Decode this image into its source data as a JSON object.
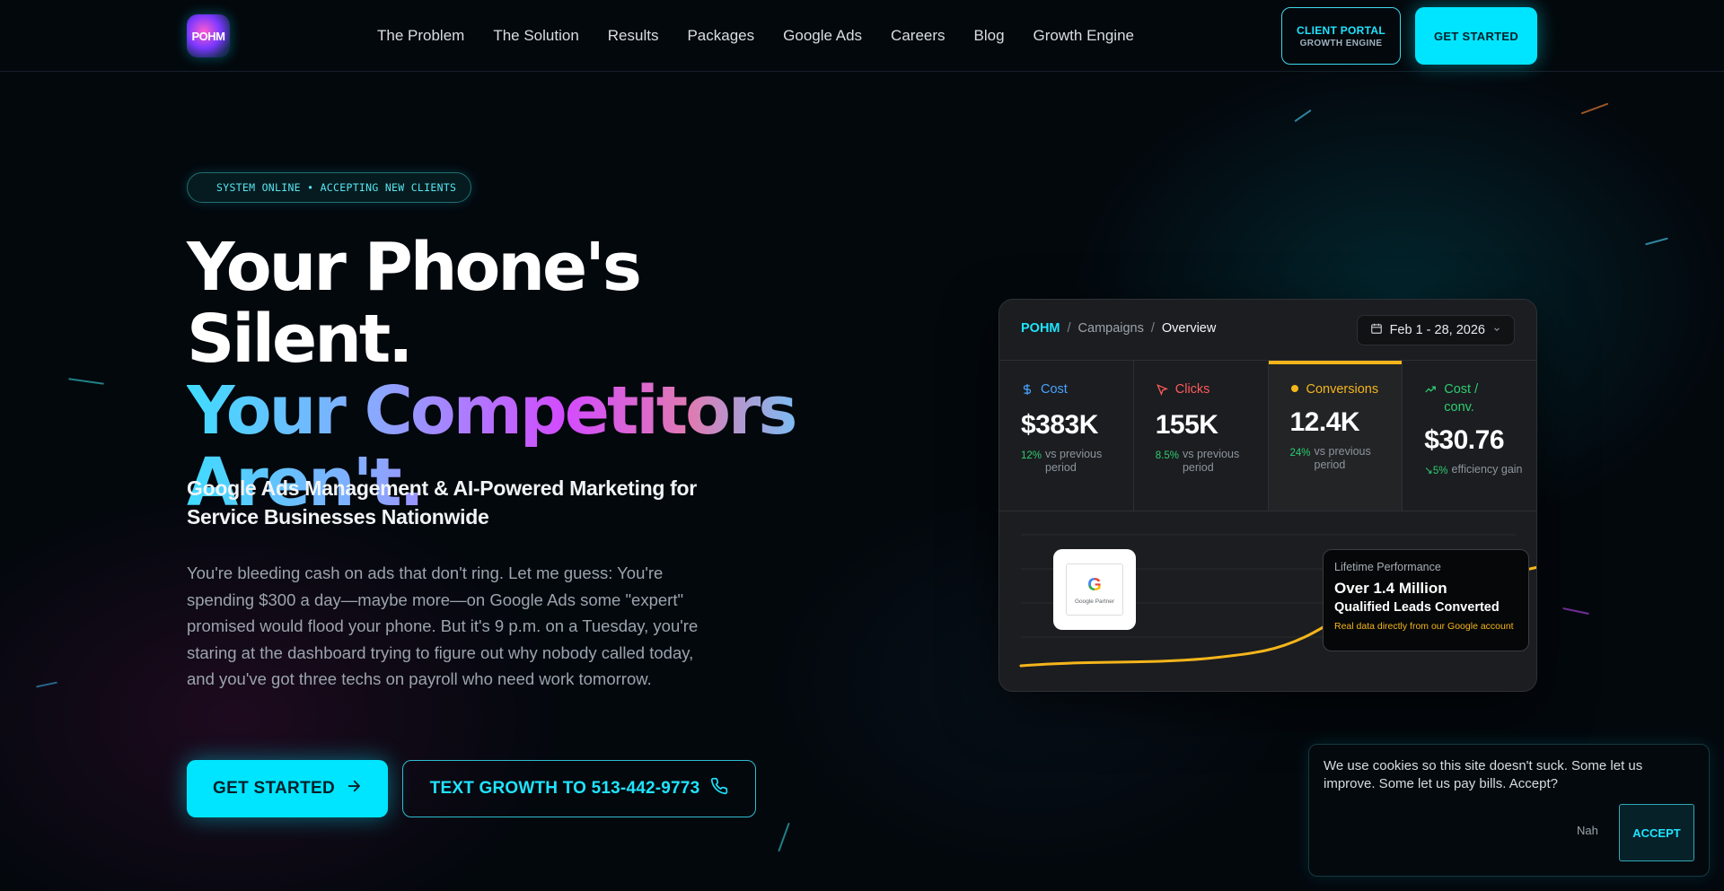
{
  "header": {
    "logo_text": "POHM",
    "nav": [
      {
        "label": "The Problem"
      },
      {
        "label": "The Solution"
      },
      {
        "label": "Results"
      },
      {
        "label": "Packages"
      },
      {
        "label": "Google Ads"
      },
      {
        "label": "Careers"
      },
      {
        "label": "Blog"
      },
      {
        "label": "Growth Engine"
      }
    ],
    "portal_label": "CLIENT PORTAL",
    "portal_sublabel": "GROWTH ENGINE",
    "start_label": "GET STARTED"
  },
  "hero": {
    "badge": "SYSTEM ONLINE • ACCEPTING NEW CLIENTS",
    "headline_line1": "Your Phone's Silent.",
    "headline_line2": "Your Competitors",
    "headline_line3": "Aren't.",
    "subhead": "Google Ads Management & AI-Powered Marketing for Service Businesses Nationwide",
    "body": "You're bleeding cash on ads that don't ring. Let me guess: You're spending $300 a day—maybe more—on Google Ads some \"expert\" promised would flood your phone. But it's 9 p.m. on a Tuesday, you're staring at the dashboard trying to figure out why nobody called today, and you've got three techs on payroll who need work tomorrow.",
    "cta_primary": "GET STARTED",
    "cta_secondary": "TEXT GROWTH TO 513-442-9773"
  },
  "dashboard": {
    "breadcrumb": [
      "POHM",
      "Campaigns",
      "Overview"
    ],
    "date_range": "Feb 1 - 28, 2026",
    "metrics": [
      {
        "label": "Cost",
        "value": "$383K",
        "pct": "12%",
        "note": "vs previous period",
        "color": "#4aa3ff",
        "icon": "dollar-icon"
      },
      {
        "label": "Clicks",
        "value": "155K",
        "pct": "8.5%",
        "note": "vs previous period",
        "color": "#ff5a5a",
        "icon": "cursor-icon"
      },
      {
        "label": "Conversions",
        "value": "12.4K",
        "pct": "24%",
        "note": "vs previous period",
        "color": "#f5b51b",
        "icon": "dot-icon"
      },
      {
        "label": "Cost / conv.",
        "value": "$30.76",
        "pct": "↘5%",
        "note": "efficiency gain",
        "color": "#2ecc71",
        "icon": "trend-up-icon"
      }
    ],
    "google_partner_label": "Google Partner",
    "tooltip": {
      "kicker": "Lifetime Performance",
      "line1": "Over 1.4 Million",
      "line2": "Qualified Leads Converted",
      "note": "Real data directly from our Google account"
    }
  },
  "cookie": {
    "text": "We use cookies so this site doesn't suck. Some let us improve. Some let us pay bills. Accept?",
    "decline": "Nah",
    "accept": "ACCEPT"
  },
  "colors": {
    "accent": "#00e5ff",
    "gold": "#f5b51b"
  }
}
